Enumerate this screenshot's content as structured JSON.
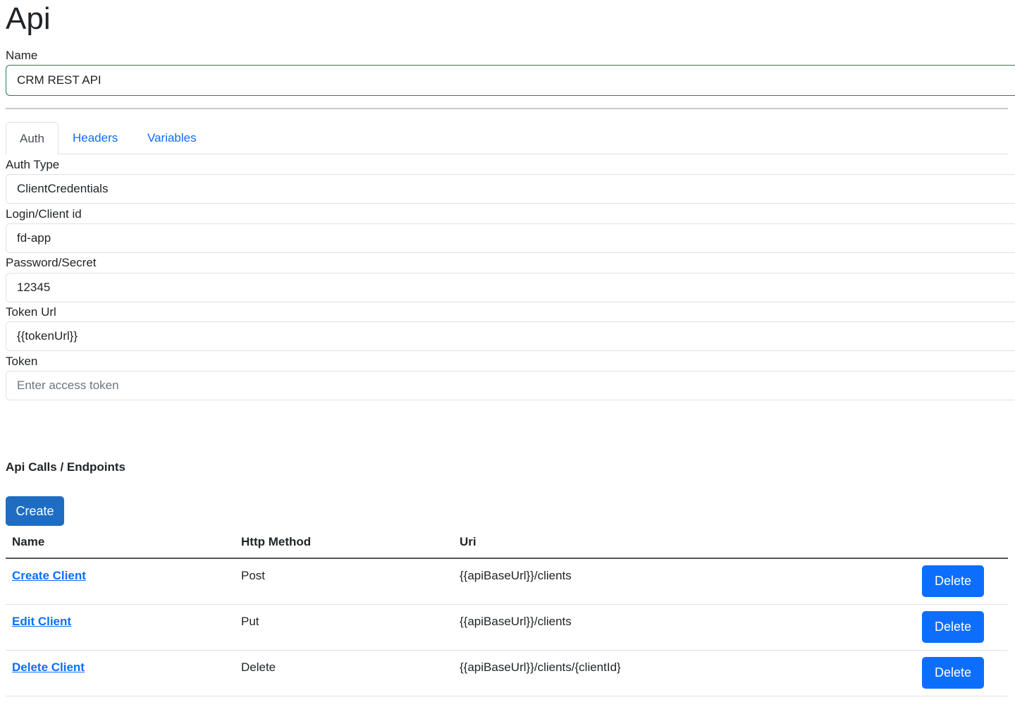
{
  "page": {
    "title": "Api"
  },
  "name_field": {
    "label": "Name",
    "value": "CRM REST API"
  },
  "tabs": [
    {
      "label": "Auth",
      "active": true
    },
    {
      "label": "Headers",
      "active": false
    },
    {
      "label": "Variables",
      "active": false
    }
  ],
  "auth": {
    "auth_type": {
      "label": "Auth Type",
      "value": "ClientCredentials"
    },
    "client_id": {
      "label": "Login/Client id",
      "value": "fd-app"
    },
    "secret": {
      "label": "Password/Secret",
      "value": "12345"
    },
    "token_url": {
      "label": "Token Url",
      "value": "{{tokenUrl}}"
    },
    "token": {
      "label": "Token",
      "value": "",
      "placeholder": "Enter access token"
    }
  },
  "endpoints": {
    "heading": "Api Calls / Endpoints",
    "create_label": "Create",
    "columns": {
      "name": "Name",
      "method": "Http Method",
      "uri": "Uri"
    },
    "rows": [
      {
        "name": "Create Client",
        "method": "Post",
        "uri": "{{apiBaseUrl}}/clients",
        "delete_label": "Delete"
      },
      {
        "name": "Edit Client",
        "method": "Put",
        "uri": "{{apiBaseUrl}}/clients",
        "delete_label": "Delete"
      },
      {
        "name": "Delete Client",
        "method": "Delete",
        "uri": "{{apiBaseUrl}}/clients/{clientId}",
        "delete_label": "Delete"
      }
    ]
  },
  "colors": {
    "primary": "#0d6efd",
    "create_button": "#1f6dc2",
    "valid_border": "#198754",
    "text": "#212529"
  }
}
